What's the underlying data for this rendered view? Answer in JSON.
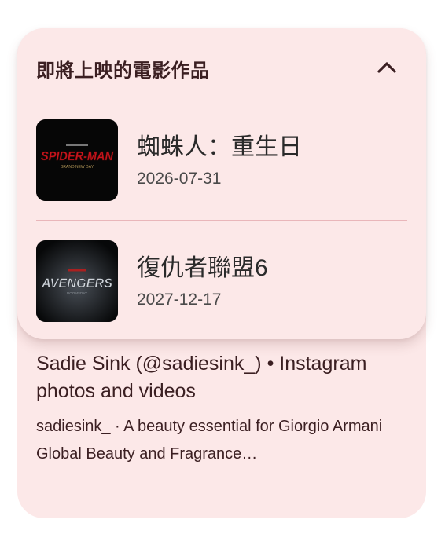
{
  "upcoming": {
    "title": "即將上映的電影作品",
    "movies": [
      {
        "title": "蜘蛛人：重生日",
        "date": "2026-07-31",
        "poster_icon": "spider-man-poster"
      },
      {
        "title": "復仇者聯盟6",
        "date": "2027-12-17",
        "poster_icon": "avengers-poster"
      }
    ]
  },
  "result": {
    "title": "Sadie Sink (@sadiesink_) • Instagram photos and videos",
    "snippet": "sadiesink_ · A beauty essential for Giorgio Armani Global Beauty and Fragrance…"
  },
  "colors": {
    "card_background": "#fce8e8",
    "title_text": "#3b1f22",
    "divider": "#e9b6ba"
  }
}
